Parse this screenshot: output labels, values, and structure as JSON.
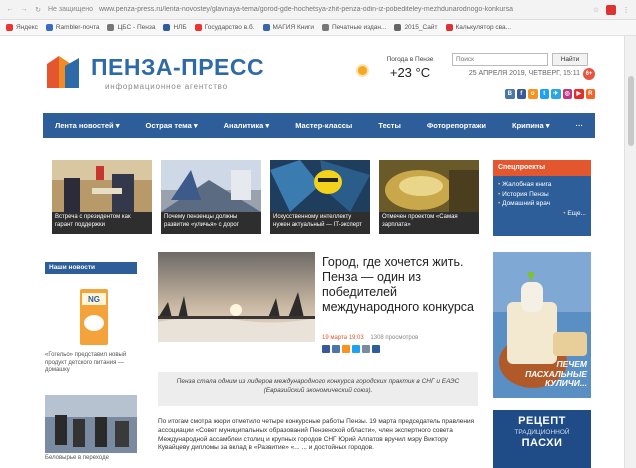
{
  "browser": {
    "url": "www.penza-press.ru/lenta-novostey/glavnaya-tema/gorod-gde-hochetsya-zhit-penza-odin-iz-pobediteley-mezhdunarodnogo-konkursa",
    "tab_prefix": "Не защищено",
    "bookmarks": [
      "Яндекс",
      "Rambler-почта",
      "ЦБС - Пенза",
      "НЛБ",
      "Государство в.б.",
      "МАГИЯ Книги",
      "Печатные издан...",
      "2015_Сайт",
      "Калькулятор сва..."
    ]
  },
  "header": {
    "logo_name": "ПЕНЗА-ПРЕСС",
    "logo_subtitle": "информационное агентство",
    "weather_city": "Погода в Пензе",
    "weather_temp": "+23 °C",
    "search_placeholder": "Поиск",
    "search_button": "Найти",
    "date": "25 АПРЕЛЯ 2019, ЧЕТВЕРГ, 15:11",
    "age_badge": "6+",
    "social": [
      {
        "name": "vk",
        "label": "В",
        "color": "#4a76a8"
      },
      {
        "name": "facebook",
        "label": "f",
        "color": "#3b5998"
      },
      {
        "name": "ok",
        "label": "о",
        "color": "#f7931e"
      },
      {
        "name": "twitter",
        "label": "t",
        "color": "#1da1f2"
      },
      {
        "name": "telegram",
        "label": "✈",
        "color": "#2ca5e0"
      },
      {
        "name": "instagram",
        "label": "◎",
        "color": "#c13584"
      },
      {
        "name": "youtube",
        "label": "▶",
        "color": "#e52d27"
      },
      {
        "name": "rss",
        "label": "R",
        "color": "#f26522"
      }
    ]
  },
  "menu": [
    "Лента новостей ▾",
    "Острая тема ▾",
    "Аналитика ▾",
    "Мастер-классы",
    "Тесты",
    "Фоторепортажи",
    "Крипина ▾",
    "···"
  ],
  "thumbnails": [
    {
      "caption": "Встреча с президентом как гарант поддержки"
    },
    {
      "caption": "Почему пензенцы должны развитие «уличья» с дорог"
    },
    {
      "caption": "Искусственному интеллекту нужен актуальный — IT-эксперт"
    },
    {
      "caption": "Отмечен проектом «Самая зарплата»"
    }
  ],
  "special_projects": {
    "title": "Спецпроекты",
    "items": [
      "Жалобная книга",
      "История Пензы",
      "Домашний врач",
      "Еще..."
    ]
  },
  "sidebar": {
    "title": "Наши новости",
    "item1": "«Гогельо» представил новый продукт детского питания — домашку",
    "item2": "Беловырье в переходе"
  },
  "article": {
    "title": "Город, где хочется жить. Пенза — один из победителей международного конкурса",
    "date": "19 марта 19:03",
    "views": "1308 просмотров",
    "lead": "Пенза стала одним из лидеров международного конкурса городских практик в СНГ и ЕАЭС (Евразийский экономический союз).",
    "body": "По итогам смотра жюри отметило четыре конкурсные работы Пензы. 19 марта председатель правления ассоциации «Совет муниципальных образований Пензенской области», член экспертного совета Международной ассамблеи столиц и крупных городов СНГ Юрий Алпатов вручил мэру Виктору Кувайцеву дипломы за вклад в «Развитие» «... ... и достойных городов."
  },
  "ads": {
    "ad1_text": "ПЕЧЕМ ПАСХАЛЬНЫЕ КУЛИЧИ...",
    "ad2_line1": "РЕЦЕПТ",
    "ad2_line2": "ТРАДИЦИОННОЙ",
    "ad2_line3": "ПАСХИ"
  }
}
